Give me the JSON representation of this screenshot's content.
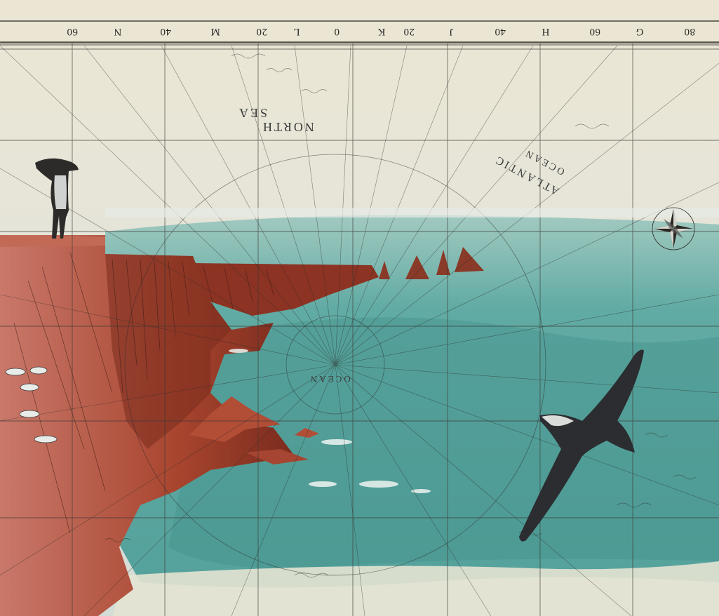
{
  "artwork": {
    "scale_labels": [
      "80",
      "G",
      "60",
      "H",
      "40",
      "J",
      "20",
      "K",
      "0",
      "L",
      "20",
      "M",
      "40",
      "N",
      "60"
    ],
    "map_labels": {
      "north": "NORTH",
      "sea": "SEA",
      "atlantic": "ATLANTIC",
      "ocean_upper": "OCEAN",
      "ocean_center": "OCEAN"
    },
    "colors": {
      "paper": "#e9e4d2",
      "sea": "#5aa8a1",
      "sea_deep": "#3f8d88",
      "cliff": "#b85a45",
      "cliff_dark": "#7a2b1d",
      "ink": "#2a2622"
    },
    "icons": [
      "compass-rose-icon",
      "albatross-icon",
      "gull-icon",
      "standing-figure-icon"
    ]
  }
}
